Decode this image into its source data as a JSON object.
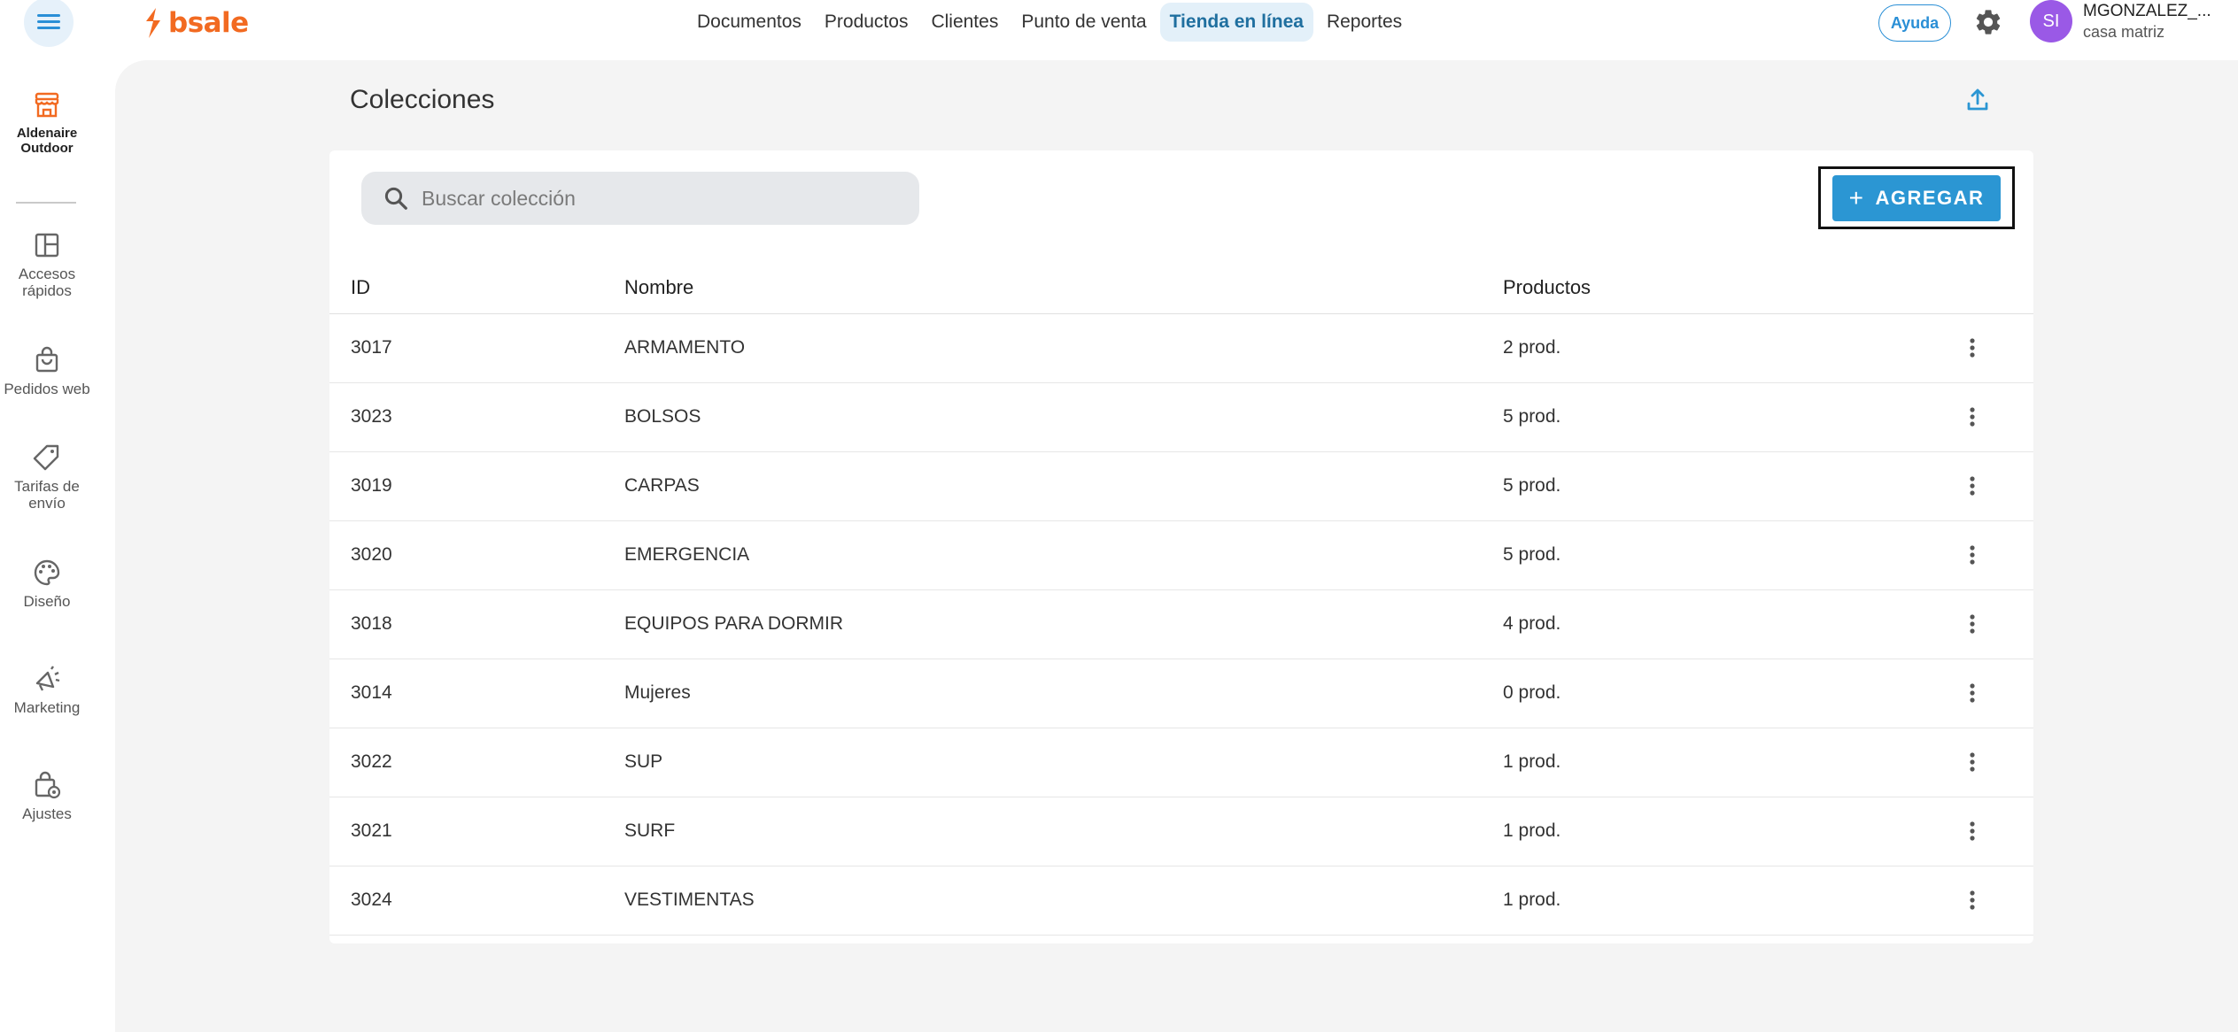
{
  "header": {
    "logo_text": "bsale",
    "nav": [
      {
        "label": "Documentos",
        "active": false
      },
      {
        "label": "Productos",
        "active": false
      },
      {
        "label": "Clientes",
        "active": false
      },
      {
        "label": "Punto de venta",
        "active": false
      },
      {
        "label": "Tienda en línea",
        "active": true
      },
      {
        "label": "Reportes",
        "active": false
      }
    ],
    "help_label": "Ayuda",
    "user": {
      "initials": "SI",
      "name": "MGONZALEZ_...",
      "branch": "casa matriz"
    }
  },
  "sidebar": {
    "store": {
      "line1": "Aldenaire",
      "line2": "Outdoor"
    },
    "items": [
      {
        "line1": "Accesos",
        "line2": "rápidos",
        "icon": "layout-icon"
      },
      {
        "line1": "Pedidos web",
        "line2": "",
        "icon": "shopping-bag-icon"
      },
      {
        "line1": "Tarifas de",
        "line2": "envío",
        "icon": "tag-icon"
      },
      {
        "line1": "Diseño",
        "line2": "",
        "icon": "palette-icon"
      },
      {
        "line1": "Marketing",
        "line2": "",
        "icon": "megaphone-icon"
      },
      {
        "line1": "Ajustes",
        "line2": "",
        "icon": "bag-settings-icon"
      }
    ]
  },
  "page": {
    "title": "Colecciones",
    "search_placeholder": "Buscar colección",
    "add_label": "AGREGAR"
  },
  "table": {
    "columns": [
      "ID",
      "Nombre",
      "Productos"
    ],
    "rows": [
      {
        "id": "3017",
        "name": "ARMAMENTO",
        "products": "2 prod."
      },
      {
        "id": "3023",
        "name": "BOLSOS",
        "products": "5 prod."
      },
      {
        "id": "3019",
        "name": "CARPAS",
        "products": "5 prod."
      },
      {
        "id": "3020",
        "name": "EMERGENCIA",
        "products": "5 prod."
      },
      {
        "id": "3018",
        "name": "EQUIPOS PARA DORMIR",
        "products": "4 prod."
      },
      {
        "id": "3014",
        "name": "Mujeres",
        "products": "0 prod."
      },
      {
        "id": "3022",
        "name": "SUP",
        "products": "1 prod."
      },
      {
        "id": "3021",
        "name": "SURF",
        "products": "1 prod."
      },
      {
        "id": "3024",
        "name": "VESTIMENTAS",
        "products": "1 prod."
      }
    ]
  },
  "colors": {
    "brand": "#f26a21",
    "accent": "#2b96d3",
    "avatar": "#9a59e6",
    "active_nav_bg": "#e3f0f9"
  }
}
